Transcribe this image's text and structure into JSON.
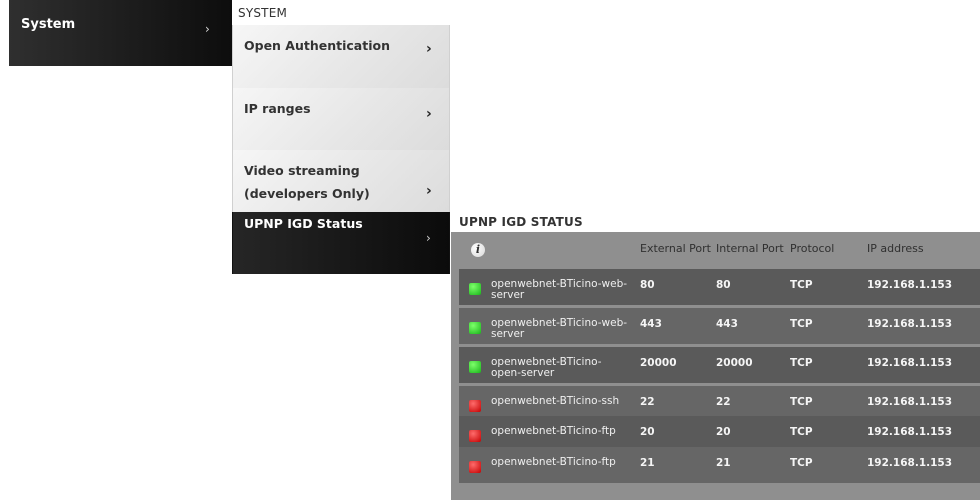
{
  "nav": {
    "system_label": "System",
    "system_chevron": "›"
  },
  "system_panel": {
    "title": "SYSTEM",
    "items": [
      {
        "label": "Open Authentication",
        "chevron": "›"
      },
      {
        "label": "IP ranges",
        "chevron": "›"
      },
      {
        "label_line1": "Video streaming",
        "label_line2": "(developers Only)",
        "chevron": "›"
      },
      {
        "label": "UPNP IGD Status",
        "chevron": "›"
      }
    ]
  },
  "upnp": {
    "title": "UPNP IGD STATUS",
    "info_icon": "info-icon",
    "headers": {
      "external_port": "External Port",
      "internal_port": "Internal Port",
      "protocol": "Protocol",
      "ip": "IP address"
    },
    "rows": [
      {
        "status": "green",
        "name": "openwebnet-BTicino-web-server",
        "ext": "80",
        "int": "80",
        "proto": "TCP",
        "ip": "192.168.1.153"
      },
      {
        "status": "green",
        "name": "openwebnet-BTicino-web-server",
        "ext": "443",
        "int": "443",
        "proto": "TCP",
        "ip": "192.168.1.153"
      },
      {
        "status": "green",
        "name": "openwebnet-BTicino-open-server",
        "ext": "20000",
        "int": "20000",
        "proto": "TCP",
        "ip": "192.168.1.153"
      },
      {
        "status": "red",
        "name": "openwebnet-BTicino-ssh",
        "ext": "22",
        "int": "22",
        "proto": "TCP",
        "ip": "192.168.1.153"
      },
      {
        "status": "red",
        "name": "openwebnet-BTicino-ftp",
        "ext": "20",
        "int": "20",
        "proto": "TCP",
        "ip": "192.168.1.153"
      },
      {
        "status": "red",
        "name": "openwebnet-BTicino-ftp",
        "ext": "21",
        "int": "21",
        "proto": "TCP",
        "ip": "192.168.1.153"
      }
    ],
    "colors": {
      "ok": "#1db91f",
      "error": "#cc0000"
    }
  }
}
